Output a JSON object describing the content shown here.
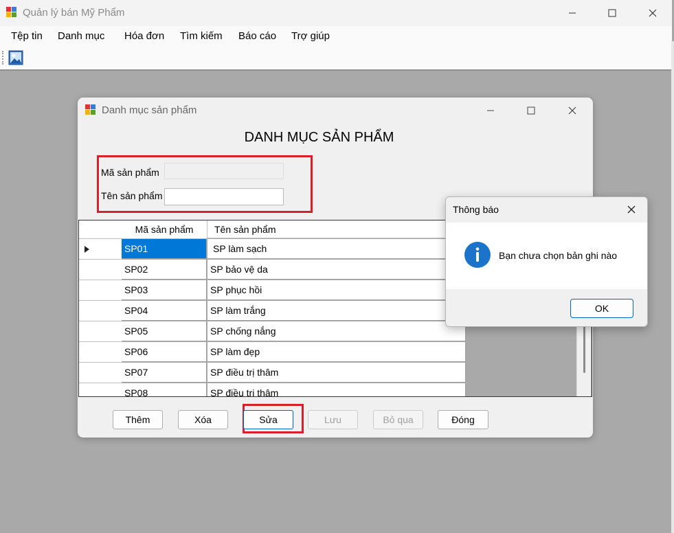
{
  "main_window": {
    "title": "Quản lý bán Mỹ Phẩm",
    "menu": [
      "Tệp tin",
      "Danh mục",
      "Hóa đơn",
      "Tìm kiếm",
      "Báo cáo",
      "Trợ giúp"
    ]
  },
  "product_form": {
    "title": "Danh mục sản phẩm",
    "heading": "DANH MỤC SẢN PHẨM",
    "code_label": "Mã sản phẩm",
    "code_value": "",
    "name_label": "Tên sản phẩm",
    "name_value": "",
    "grid": {
      "columns": [
        "Mã sản phẩm",
        "Tên sản phẩm"
      ],
      "rows": [
        [
          "SP01",
          "SP làm sạch"
        ],
        [
          "SP02",
          "SP bảo vệ da"
        ],
        [
          "SP03",
          "SP phục hồi"
        ],
        [
          "SP04",
          "SP làm trắng"
        ],
        [
          "SP05",
          "SP chống nắng"
        ],
        [
          "SP06",
          "SP làm đẹp"
        ],
        [
          "SP07",
          "SP điều trị thâm"
        ],
        [
          "SP08",
          "SP điều trị thâm"
        ]
      ],
      "selected_row": 0
    },
    "buttons": {
      "add": "Thêm",
      "delete": "Xóa",
      "edit": "Sửa",
      "save": "Lưu",
      "skip": "Bỏ qua",
      "close": "Đóng"
    },
    "highlight_color": "#d9202a"
  },
  "message_box": {
    "title": "Thông báo",
    "message": "Bạn chưa chọn bản ghi nào",
    "ok": "OK",
    "info_icon_color": "#1b74c9"
  }
}
